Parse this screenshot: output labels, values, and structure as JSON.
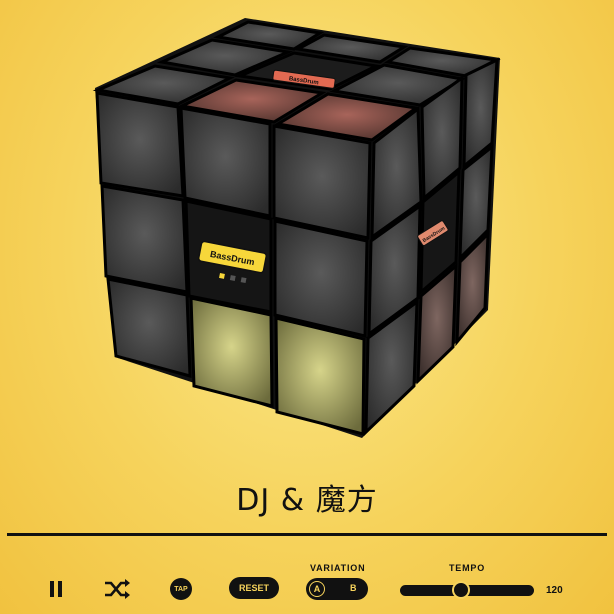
{
  "app": {
    "title": "DJ & 魔方"
  },
  "cube": {
    "pads": [
      {
        "label": "BassDrum",
        "state": "selected"
      },
      {
        "label": "BassDrum",
        "state": "highlighted"
      },
      {
        "label": "BassDrum",
        "state": "side"
      }
    ],
    "colors": {
      "face_dark": "#3a3a3a",
      "active_red": "#b4574f",
      "active_yellow": "#d8d78a",
      "label_yellow": "#f7d73a",
      "label_red": "#e26a52"
    }
  },
  "controls": {
    "pause_icon": "pause-icon",
    "shuffle_icon": "shuffle-icon",
    "tap_label": "TAP",
    "reset_label": "RESET",
    "variation_label": "VARIATION",
    "variation_a": "A",
    "variation_b": "B",
    "variation_selected": "A",
    "tempo_label": "TEMPO",
    "tempo_value": "120",
    "tempo_fraction": 0.45
  }
}
